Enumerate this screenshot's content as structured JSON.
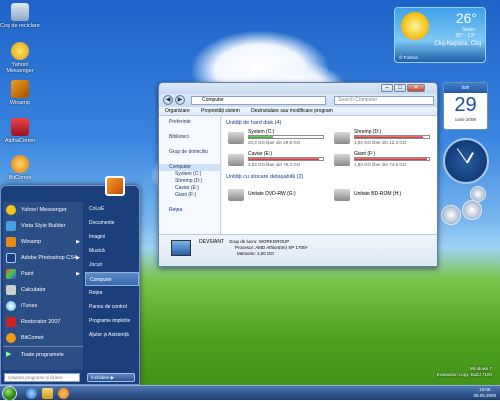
{
  "desktop": {
    "icons": [
      {
        "label": "Coș de reciclare"
      },
      {
        "label": "Yahoo! Messenger"
      },
      {
        "label": "Winamp"
      },
      {
        "label": "AlphaComm"
      },
      {
        "label": "BitComet"
      }
    ]
  },
  "explorer": {
    "address": "Computer",
    "search_placeholder": "Search Computer",
    "toolbar": [
      "Organizare",
      "Proprietăți sistem",
      "Dezinstalare sau modificare program"
    ],
    "nav": [
      {
        "label": "Preferinte"
      },
      {
        "label": "Biblioteci"
      },
      {
        "label": "Grup de domiciliu"
      },
      {
        "label": "Computer"
      },
      {
        "label": "System (C:)"
      },
      {
        "label": "Shremp (D:)"
      },
      {
        "label": "Caviar (E:)"
      },
      {
        "label": "Giant (F:)"
      },
      {
        "label": "Rețea"
      }
    ],
    "section_hdd": "Unități de hard disk (4)",
    "drives": [
      {
        "name": "System (C:)",
        "free": "20,3 GO liber din 29,8 GO",
        "used": 0.32
      },
      {
        "name": "Shremp (D:)",
        "free": "1,04 GO liber din 12,3 GO",
        "used": 0.92
      },
      {
        "name": "Caviar (E:)",
        "free": "3,53 GO liber din 76,3 GO",
        "used": 0.95
      },
      {
        "name": "Giant (F:)",
        "free": "1,83 GO liber din 74,5 GO",
        "used": 0.97
      }
    ],
    "section_removable": "Unități cu stocare detașabilă (2)",
    "removable": [
      {
        "name": "Unitate DVD-RW (G:)"
      },
      {
        "name": "Unitate BD-ROM (H:)"
      }
    ],
    "details": {
      "name": "DEVSIANT",
      "workgroup": "Grup de lucru: WORKGROUP",
      "processor": "Procesor: AMD Athlon(tm) XP 1700+",
      "memory": "Memorie: 1,00 GO"
    }
  },
  "start_menu": {
    "left": [
      {
        "label": "Yahoo! Messenger"
      },
      {
        "label": "Vista Style Builder"
      },
      {
        "label": "Winamp"
      },
      {
        "label": "Adobe Photoshop CS4"
      },
      {
        "label": "Paint"
      },
      {
        "label": "Calculator"
      },
      {
        "label": "iTunes"
      },
      {
        "label": "Restorator 2007"
      },
      {
        "label": "BitComet"
      },
      {
        "label": "Toate programele"
      }
    ],
    "right": [
      {
        "label": "CoLoE"
      },
      {
        "label": "Documente"
      },
      {
        "label": "Imagini"
      },
      {
        "label": "Muzică"
      },
      {
        "label": "Jocuri"
      },
      {
        "label": "Computer"
      },
      {
        "label": "Rețea"
      },
      {
        "label": "Panou de control"
      },
      {
        "label": "Programe implicite"
      },
      {
        "label": "Ajutor și Asistență"
      }
    ],
    "search_placeholder": "Căutare programe și fișiere",
    "shutdown_label": "Închidere"
  },
  "weather": {
    "temp": "26°",
    "small": "Senin",
    "range": "30° - 13°",
    "city": "Cluj-Napoca, Cluj",
    "source": "© Foreca"
  },
  "calendar": {
    "weekday": "luni",
    "day": "29",
    "month_year": "iunie 2009"
  },
  "taskbar": {
    "time": "15:06",
    "date": "29.06.2009"
  },
  "watermark": {
    "line1": "Windows 7",
    "line2": "Evaluation copy. Build 7100"
  }
}
